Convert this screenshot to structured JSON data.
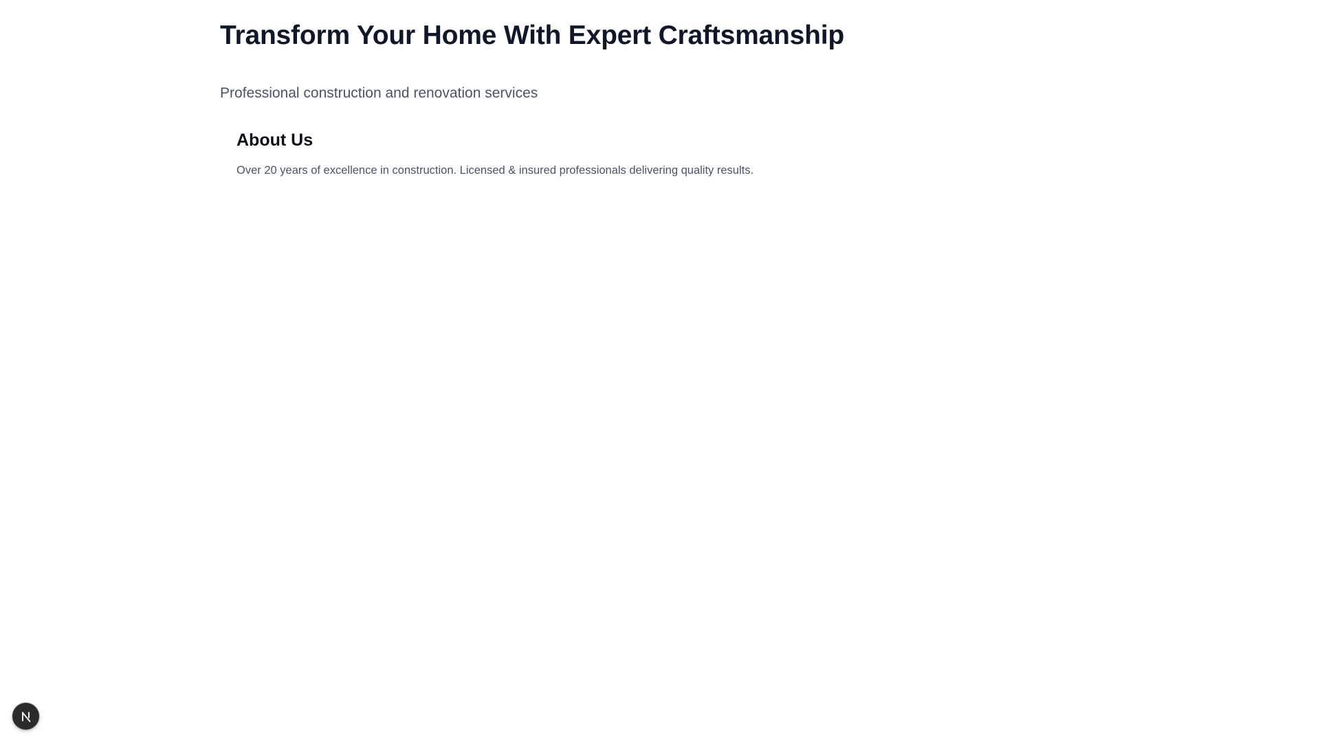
{
  "hero": {
    "title": "Transform Your Home With Expert Craftsmanship",
    "subtitle": "Professional construction and renovation services"
  },
  "about": {
    "title": "About Us",
    "text": "Over 20 years of excellence in construction. Licensed & insured professionals delivering quality results."
  },
  "dev_badge": {
    "icon": "nextjs-logo-icon",
    "background": "#2b2b2b"
  },
  "colors": {
    "heading": "#0f172a",
    "body_text": "#475569",
    "page_background": "#ffffff"
  }
}
